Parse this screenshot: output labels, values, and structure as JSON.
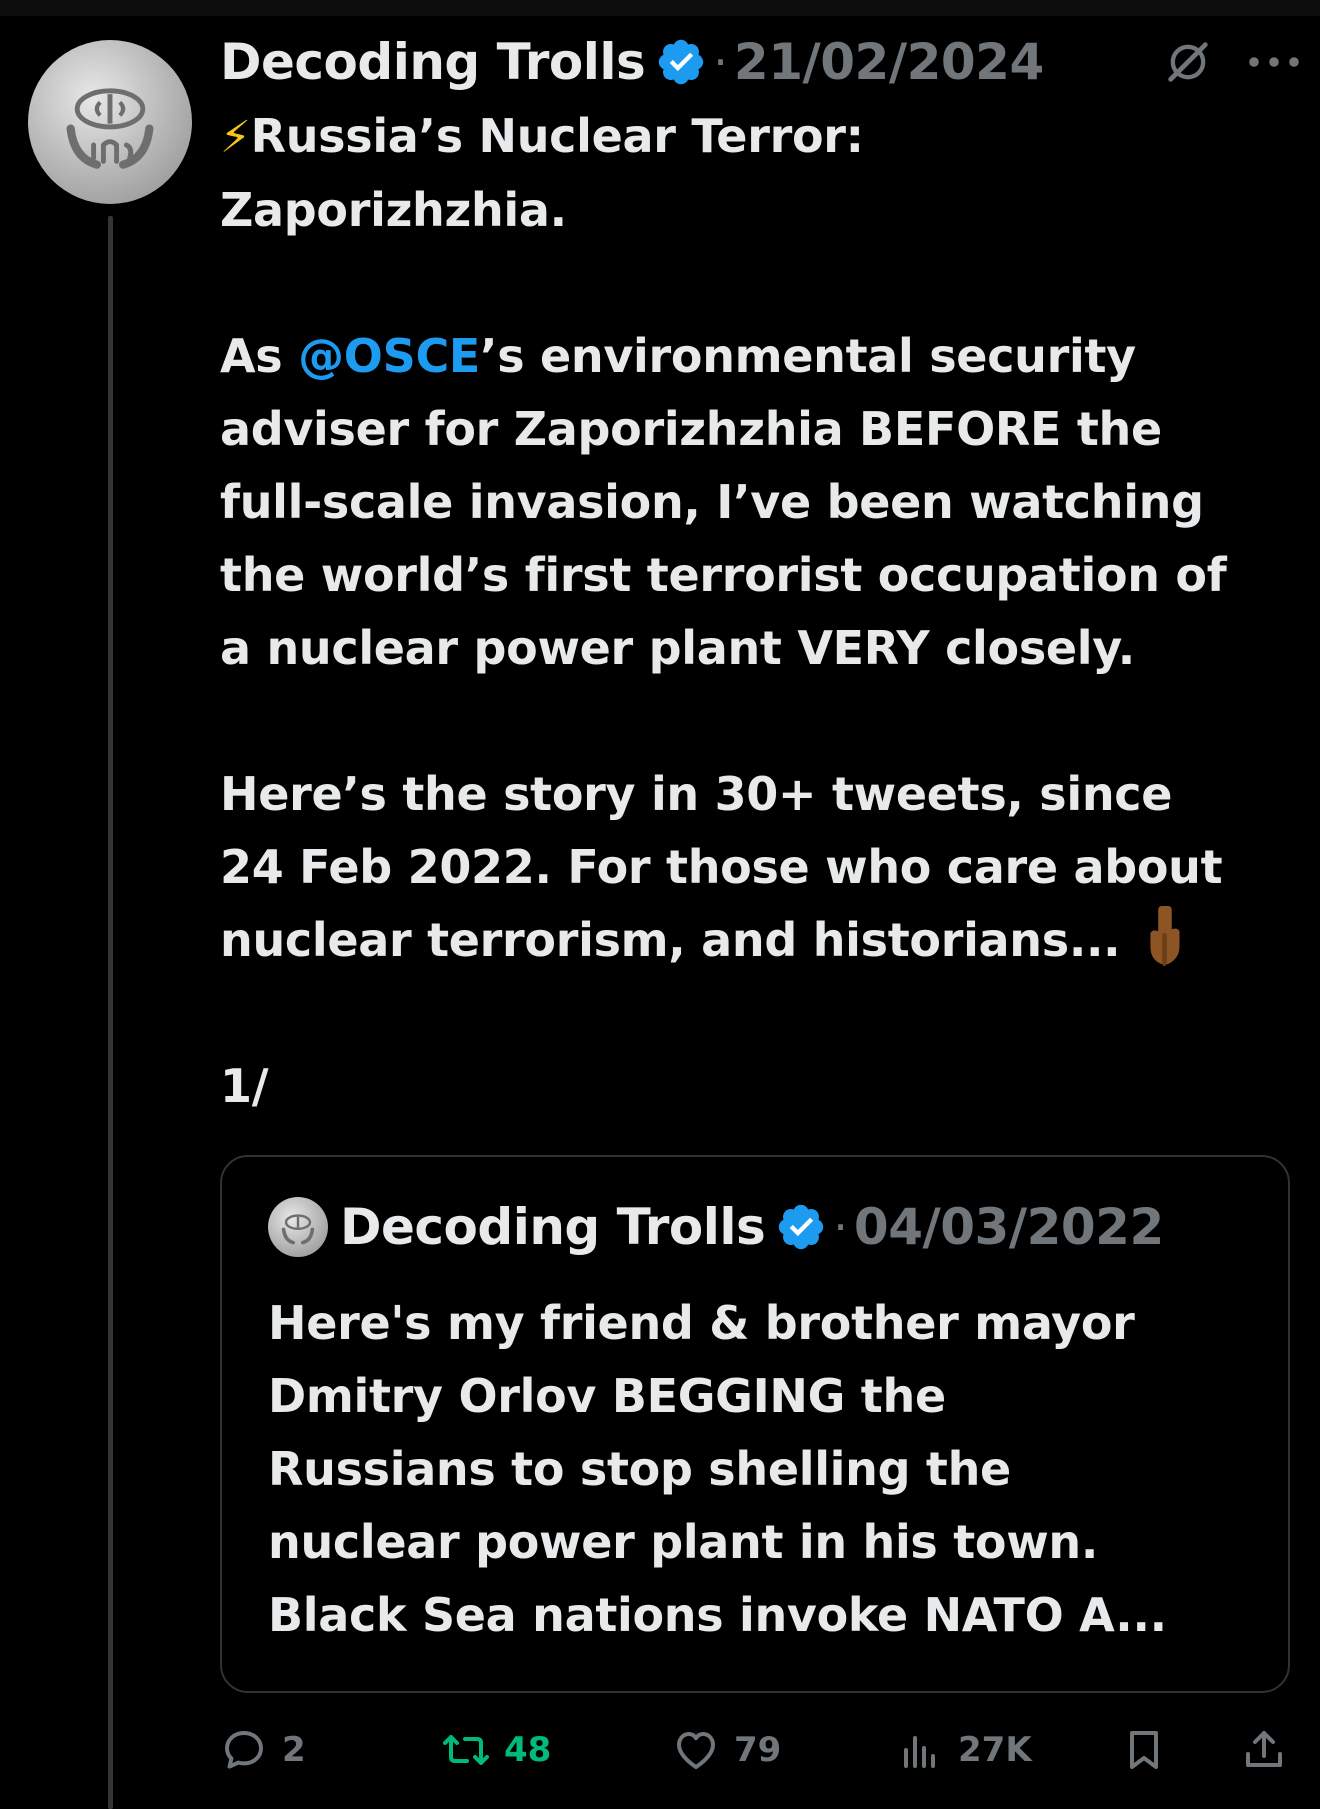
{
  "tweet": {
    "author_name": "Decoding Trolls",
    "date": "21/02/2024",
    "separator": "·",
    "lightning_emoji": "⚡",
    "line1": "Russia’s Nuclear Terror:",
    "line2": "Zaporizhzhia.",
    "para2_prefix": "As ",
    "mention": "@OSCE",
    "para2_rest": "’s environmental security\nadviser for Zaporizhzhia BEFORE the\nfull-scale invasion, I’ve been watching\nthe world’s first terrorist occupation of\na nuclear power plant VERY closely.",
    "para3": "Here’s the story in 30+ tweets, since\n24 Feb 2022. For those who care about\nnuclear terrorism, and historians...",
    "thread_marker": "1/"
  },
  "quoted_tweet": {
    "author_name": "Decoding Trolls",
    "date": "04/03/2022",
    "separator": "·",
    "text": "Here's my friend & brother mayor\nDmitry Orlov BEGGING the\nRussians to stop shelling the\nnuclear power plant in his town.\nBlack Sea nations invoke NATO A..."
  },
  "actions": {
    "replies": "2",
    "retweets": "48",
    "likes": "79",
    "views": "27K"
  },
  "icons": {
    "verified": "verified-badge-icon",
    "grok": "grok-icon",
    "more": "more-icon",
    "reply": "reply-icon",
    "retweet": "retweet-icon",
    "like": "heart-icon",
    "views": "views-icon",
    "bookmark": "bookmark-icon",
    "share": "share-icon",
    "pointing": "pointing-down-emoji"
  },
  "colors": {
    "background": "#000000",
    "text": "#e7e9ea",
    "secondary": "#71767b",
    "accent": "#1d9bf0",
    "retweet": "#00ba7c",
    "border": "#2f3336"
  }
}
